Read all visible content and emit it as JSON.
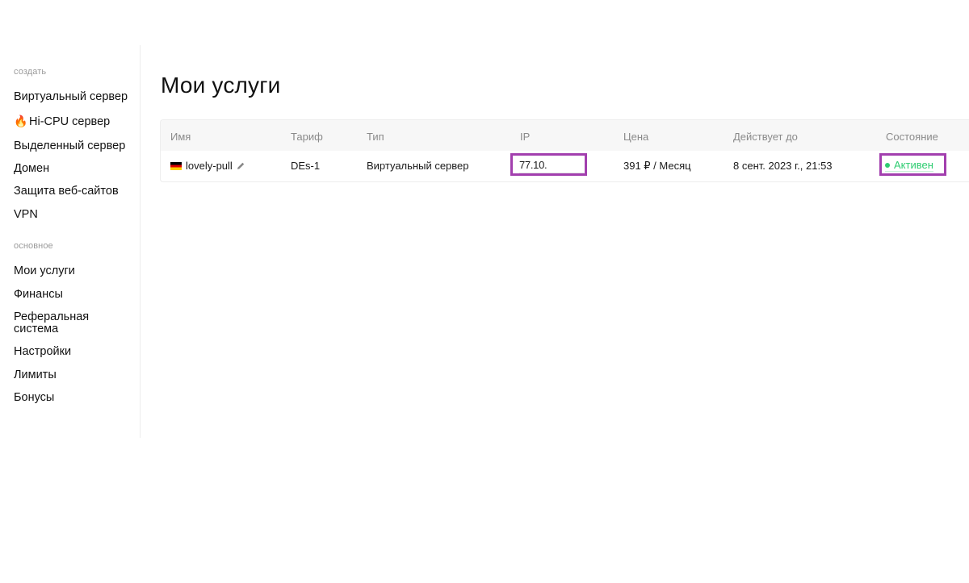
{
  "sidebar": {
    "section_create": "создать",
    "create_items": [
      {
        "label": "Виртуальный сервер"
      },
      {
        "label": "Hi-CPU сервер",
        "icon": "🔥"
      },
      {
        "label": "Выделенный сервер"
      },
      {
        "label": "Домен"
      },
      {
        "label": "Защита веб-сайтов"
      },
      {
        "label": "VPN"
      }
    ],
    "section_main": "основное",
    "main_items": [
      {
        "label": "Мои услуги"
      },
      {
        "label": "Финансы"
      },
      {
        "label": "Реферальная система"
      },
      {
        "label": "Настройки"
      },
      {
        "label": "Лимиты"
      },
      {
        "label": "Бонусы"
      }
    ]
  },
  "main": {
    "title": "Мои услуги",
    "table": {
      "columns": [
        "Имя",
        "Тариф",
        "Тип",
        "IP",
        "Цена",
        "Действует до",
        "Состояние"
      ],
      "rows": [
        {
          "name": "lovely-pull",
          "flag": "germany-flag-icon",
          "tariff": "DEs-1",
          "type": "Виртуальный сервер",
          "ip": "77.10.",
          "price": "391 ₽ / Месяц",
          "valid_until": "8 сент. 2023 г., 21:53",
          "status": "Активен"
        }
      ]
    }
  },
  "colors": {
    "highlight": "#a23fae",
    "status_active": "#2ecc71"
  }
}
